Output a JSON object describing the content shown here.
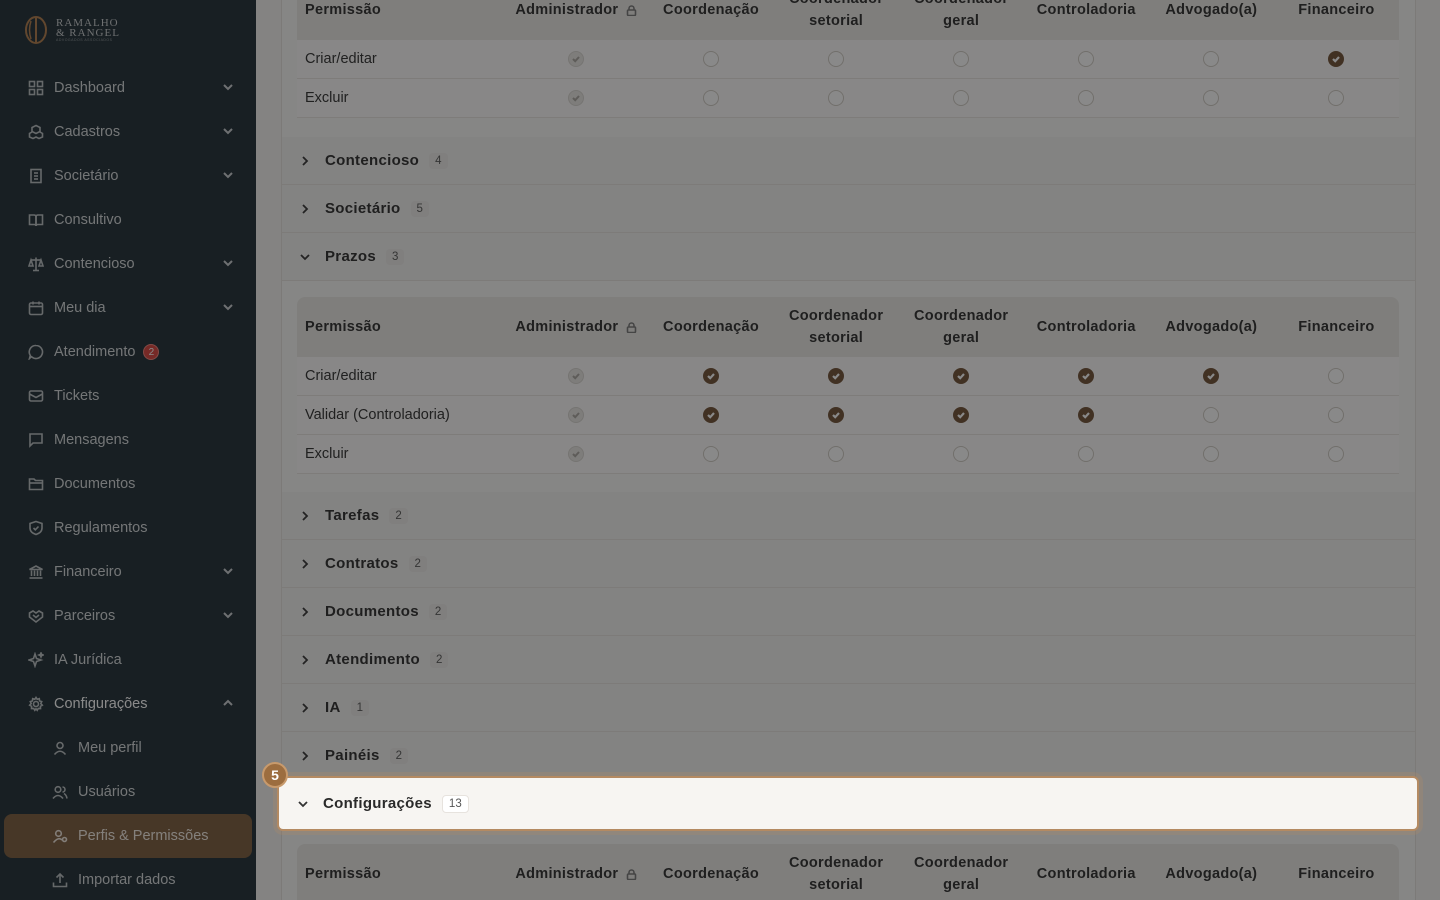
{
  "brand": {
    "line1": "RAMALHO",
    "line2": "& RANGEL",
    "line3": "ADVOGADOS ASSOCIADOS"
  },
  "sidebar": {
    "items": [
      {
        "label": "Dashboard",
        "icon": "grid-icon",
        "chevron": "down"
      },
      {
        "label": "Cadastros",
        "icon": "boxes-icon",
        "chevron": "down"
      },
      {
        "label": "Societário",
        "icon": "building-icon",
        "chevron": "down"
      },
      {
        "label": "Consultivo",
        "icon": "book-icon",
        "chevron": ""
      },
      {
        "label": "Contencioso",
        "icon": "scale-icon",
        "chevron": "down"
      },
      {
        "label": "Meu dia",
        "icon": "calendar-icon",
        "chevron": "down"
      },
      {
        "label": "Atendimento",
        "icon": "chat-icon",
        "chevron": "",
        "badge": "2"
      },
      {
        "label": "Tickets",
        "icon": "ticket-icon",
        "chevron": ""
      },
      {
        "label": "Mensagens",
        "icon": "message-icon",
        "chevron": ""
      },
      {
        "label": "Documentos",
        "icon": "folder-icon",
        "chevron": ""
      },
      {
        "label": "Regulamentos",
        "icon": "shield-icon",
        "chevron": ""
      },
      {
        "label": "Financeiro",
        "icon": "bank-icon",
        "chevron": "down"
      },
      {
        "label": "Parceiros",
        "icon": "handshake-icon",
        "chevron": "down"
      },
      {
        "label": "IA Jurídica",
        "icon": "sparkle-icon",
        "chevron": ""
      },
      {
        "label": "Configurações",
        "icon": "gear-icon",
        "chevron": "up"
      }
    ],
    "subitems": [
      {
        "label": "Meu perfil",
        "icon": "user-icon"
      },
      {
        "label": "Usuários",
        "icon": "users-icon"
      },
      {
        "label": "Perfis & Permissões",
        "icon": "user-cog-icon",
        "active": true
      },
      {
        "label": "Importar dados",
        "icon": "upload-icon"
      }
    ]
  },
  "table_headers": {
    "permission": "Permissão",
    "admin": "Administrador",
    "coordenacao": "Coordenação",
    "coord_setorial_1": "Coordenador",
    "coord_setorial_2": "setorial",
    "coord_geral_1": "Coordenador",
    "coord_geral_2": "geral",
    "controladoria": "Controladoria",
    "advogado": "Advogado(a)",
    "financeiro": "Financeiro"
  },
  "top_table": {
    "rows": [
      {
        "label": "Criar/editar",
        "values": [
          false,
          false,
          false,
          false,
          false,
          true
        ]
      },
      {
        "label": "Excluir",
        "values": [
          false,
          false,
          false,
          false,
          false,
          false
        ]
      }
    ]
  },
  "sections": [
    {
      "name": "Contencioso",
      "count": "4",
      "expanded": false
    },
    {
      "name": "Societário",
      "count": "5",
      "expanded": false
    },
    {
      "name": "Prazos",
      "count": "3",
      "expanded": true
    },
    {
      "name": "Tarefas",
      "count": "2",
      "expanded": false
    },
    {
      "name": "Contratos",
      "count": "2",
      "expanded": false
    },
    {
      "name": "Documentos",
      "count": "2",
      "expanded": false
    },
    {
      "name": "Atendimento",
      "count": "2",
      "expanded": false
    },
    {
      "name": "IA",
      "count": "1",
      "expanded": false
    },
    {
      "name": "Painéis",
      "count": "2",
      "expanded": false
    }
  ],
  "prazos_table": {
    "rows": [
      {
        "label": "Criar/editar",
        "values": [
          true,
          true,
          true,
          true,
          true,
          false
        ]
      },
      {
        "label": "Validar (Controladoria)",
        "values": [
          true,
          true,
          true,
          true,
          false,
          false
        ]
      },
      {
        "label": "Excluir",
        "values": [
          false,
          false,
          false,
          false,
          false,
          false
        ]
      }
    ]
  },
  "highlight": {
    "step": "5",
    "name": "Configurações",
    "count": "13"
  },
  "colors": {
    "sidebar": "#1d2b33",
    "accent": "#7a5a3b",
    "checked": "#6f4f33",
    "badge": "#d9413a"
  }
}
